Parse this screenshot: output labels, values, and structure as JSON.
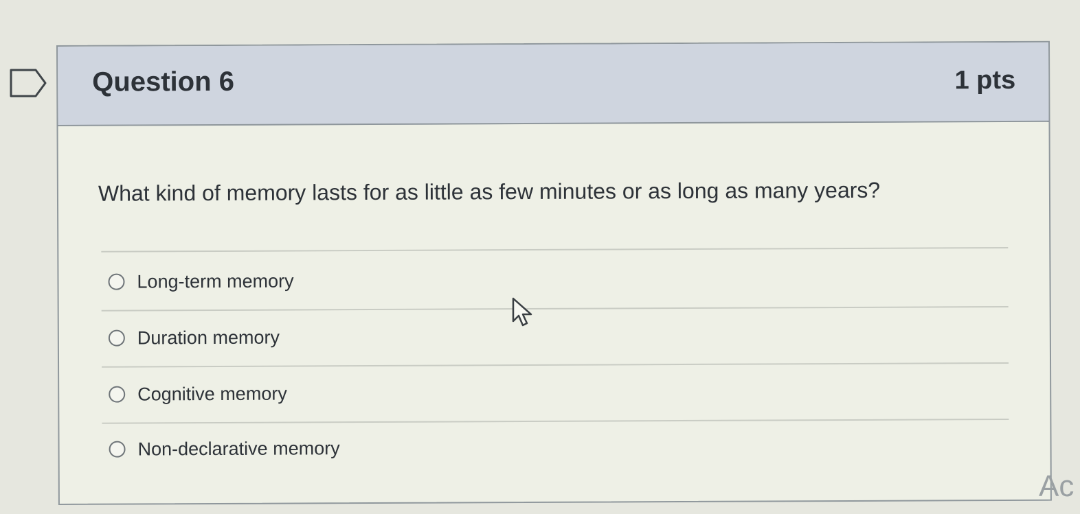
{
  "question": {
    "title": "Question 6",
    "points": "1 pts",
    "text": "What kind of memory lasts for as little as few minutes or as long as many years?"
  },
  "answers": [
    {
      "label": "Long-term memory",
      "selected": false
    },
    {
      "label": "Duration memory",
      "selected": false
    },
    {
      "label": "Cognitive memory",
      "selected": false
    },
    {
      "label": "Non-declarative memory",
      "selected": false
    }
  ],
  "corner_text": "Ac",
  "icons": {
    "flag": "flag-outline-icon",
    "cursor": "mouse-pointer-icon"
  },
  "colors": {
    "header_bg": "#cfd5df",
    "card_bg": "#eef0e6",
    "border": "#8f979c",
    "text": "#2d3238"
  }
}
